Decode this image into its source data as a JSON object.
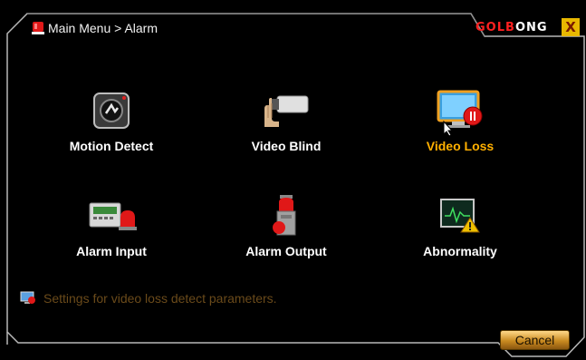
{
  "window": {
    "title": "Main Menu > Alarm",
    "brand_part1": "GOL",
    "brand_part2": "B",
    "brand_part3": "ONG",
    "close_glyph": "X"
  },
  "menu": {
    "items": [
      {
        "label": "Motion Detect",
        "icon": "motion-detect-icon",
        "selected": false
      },
      {
        "label": "Video Blind",
        "icon": "video-blind-icon",
        "selected": false
      },
      {
        "label": "Video Loss",
        "icon": "video-loss-icon",
        "selected": true
      },
      {
        "label": "Alarm Input",
        "icon": "alarm-input-icon",
        "selected": false
      },
      {
        "label": "Alarm Output",
        "icon": "alarm-output-icon",
        "selected": false
      },
      {
        "label": "Abnormality",
        "icon": "abnormality-icon",
        "selected": false
      }
    ]
  },
  "status": {
    "text": "Settings for video loss detect parameters."
  },
  "footer": {
    "cancel_label": "Cancel"
  },
  "colors": {
    "frame": "#b8b8b8",
    "accent": "#ffb000",
    "brand_red": "#ff2020",
    "status_text": "#6a4a1a"
  }
}
